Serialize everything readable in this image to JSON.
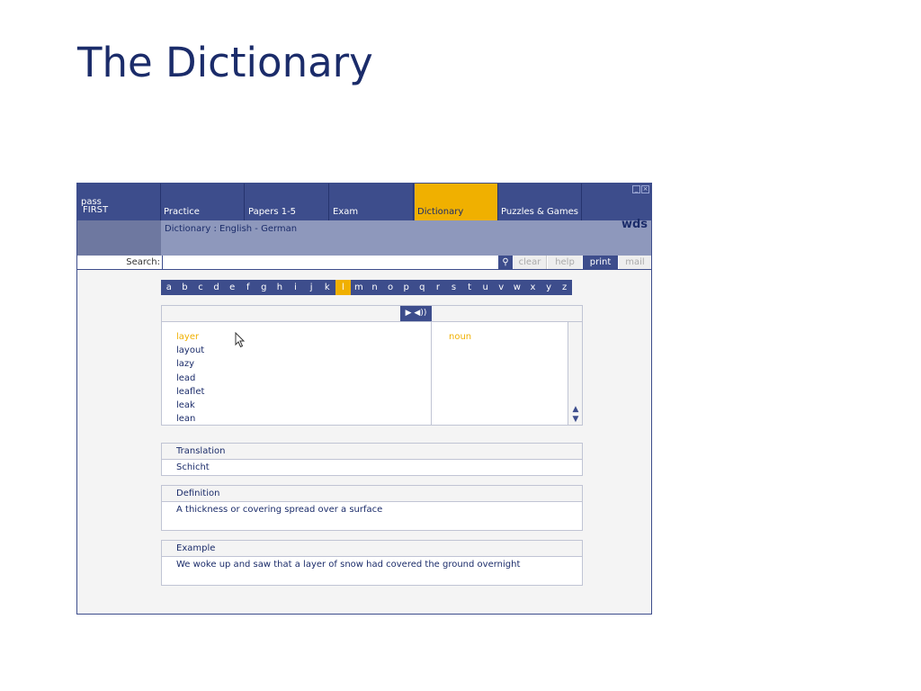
{
  "slide": {
    "title": "The Dictionary"
  },
  "brand": {
    "line1": "pass",
    "line2": "FIRST"
  },
  "nav": {
    "tabs": [
      {
        "label": "Practice"
      },
      {
        "label": "Papers 1-5"
      },
      {
        "label": "Exam"
      },
      {
        "label": "Dictionary",
        "active": true
      },
      {
        "label": "Puzzles & Games"
      }
    ]
  },
  "subbar": {
    "breadcrumb": "Dictionary : English - German",
    "logo": "wds"
  },
  "search": {
    "label": "Search:",
    "value": "",
    "clear": "clear",
    "help": "help",
    "print": "print",
    "mail": "mail"
  },
  "alphabet": {
    "letters": [
      "a",
      "b",
      "c",
      "d",
      "e",
      "f",
      "g",
      "h",
      "i",
      "j",
      "k",
      "l",
      "m",
      "n",
      "o",
      "p",
      "q",
      "r",
      "s",
      "t",
      "u",
      "v",
      "w",
      "x",
      "y",
      "z"
    ],
    "active": "l"
  },
  "words": {
    "items": [
      "layer",
      "layout",
      "lazy",
      "lead",
      "leaflet",
      "leak",
      "lean"
    ],
    "selected": "layer",
    "part_of_speech": "noun"
  },
  "translation": {
    "heading": "Translation",
    "text": "Schicht"
  },
  "definition": {
    "heading": "Definition",
    "text": "A thickness or covering spread over a surface"
  },
  "example": {
    "heading": "Example",
    "text": "We woke up and saw that a layer of snow had covered the ground overnight"
  },
  "colors": {
    "navy": "#3d4d8c",
    "accent": "#f0b000",
    "title": "#1b2c6a"
  }
}
